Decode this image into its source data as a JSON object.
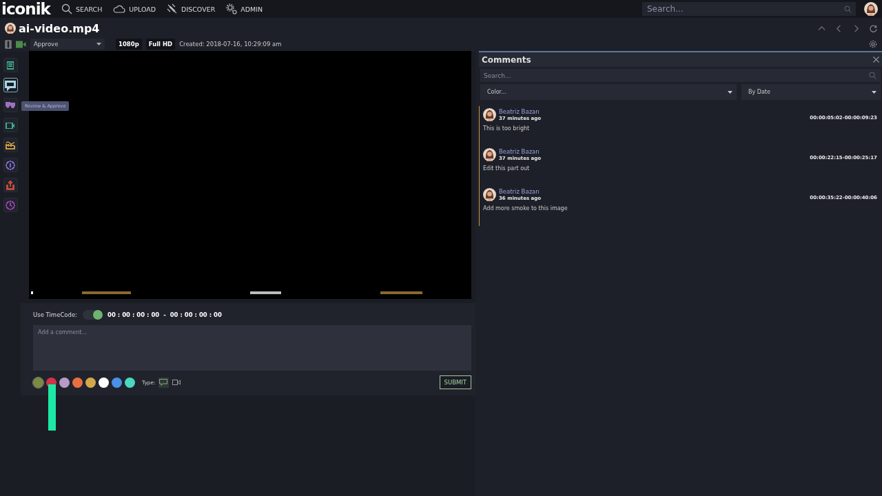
{
  "topbar": {
    "logo": "iconik",
    "nav": [
      {
        "kind": "search",
        "label": "SEARCH"
      },
      {
        "kind": "upload",
        "label": "UPLOAD"
      },
      {
        "kind": "discover",
        "label": "DISCOVER"
      },
      {
        "kind": "admin",
        "label": "ADMIN"
      }
    ],
    "search_placeholder": "Search..."
  },
  "asset": {
    "title": "ai-video.mp4",
    "status": "Approve",
    "badges": [
      "1080p",
      "Full HD"
    ],
    "created": "Created: 2018-07-16, 10:29:09 am"
  },
  "rail": {
    "items": [
      {
        "kind": "notes",
        "color": "#3fae8a",
        "selected": false
      },
      {
        "kind": "comments",
        "color": "#a9d6e5",
        "selected": true
      },
      {
        "kind": "review",
        "color": "#a070c0",
        "selected": false
      },
      {
        "kind": "camera",
        "color": "#3fae8a",
        "selected": false
      },
      {
        "kind": "factory",
        "color": "#c89a40",
        "selected": false
      },
      {
        "kind": "info",
        "color": "#7a6ad0",
        "selected": false
      },
      {
        "kind": "share",
        "color": "#c04a3a",
        "selected": false
      },
      {
        "kind": "history",
        "color": "#9a40b0",
        "selected": false
      }
    ],
    "tooltip": "Review & Approve"
  },
  "player": {
    "markers": [
      {
        "color": "#ffffff"
      },
      {
        "color": "#8a6a30"
      },
      {
        "color": "#bdbdbd"
      },
      {
        "color": "#8a6a30"
      }
    ]
  },
  "composer": {
    "timecode_label": "Use TimeCode:",
    "timecode_on": true,
    "timecode": "00 : 00 : 00 : 00  -  00 : 00 : 00 : 00",
    "placeholder": "Add a comment...",
    "swatches": [
      {
        "color": "#7a8a40",
        "selected": true
      },
      {
        "color": "#d0334a",
        "selected": false
      },
      {
        "color": "#b89ac8",
        "selected": false
      },
      {
        "color": "#e87040",
        "selected": false
      },
      {
        "color": "#d4a84a",
        "selected": false
      },
      {
        "color": "#ffffff",
        "selected": false
      },
      {
        "color": "#4a90e8",
        "selected": false
      },
      {
        "color": "#4ad8c0",
        "selected": false
      }
    ],
    "type_label": "Type:",
    "types": [
      {
        "kind": "comment",
        "selected": true
      },
      {
        "kind": "camera",
        "selected": false
      }
    ],
    "submit": "SUBMIT"
  },
  "comments": {
    "title": "Comments",
    "search_placeholder": "Search...",
    "color_filter": "Color...",
    "sort": "By Date",
    "items": [
      {
        "author": "Beatriz Bazan",
        "time": "37 minutes ago",
        "range": "00:00:05:02-00:00:09:23",
        "text": "This is too bright",
        "color": "#c8963a"
      },
      {
        "author": "Beatriz Bazan",
        "time": "37 minutes ago",
        "range": "00:00:22:15-00:00:25:17",
        "text": "Edit this part out",
        "color": "#c8963a"
      },
      {
        "author": "Beatriz Bazan",
        "time": "36 minutes ago",
        "range": "00:00:35:22-00:00:40:06",
        "text": "Add more smoke to this image",
        "color": "#c8963a"
      }
    ]
  }
}
